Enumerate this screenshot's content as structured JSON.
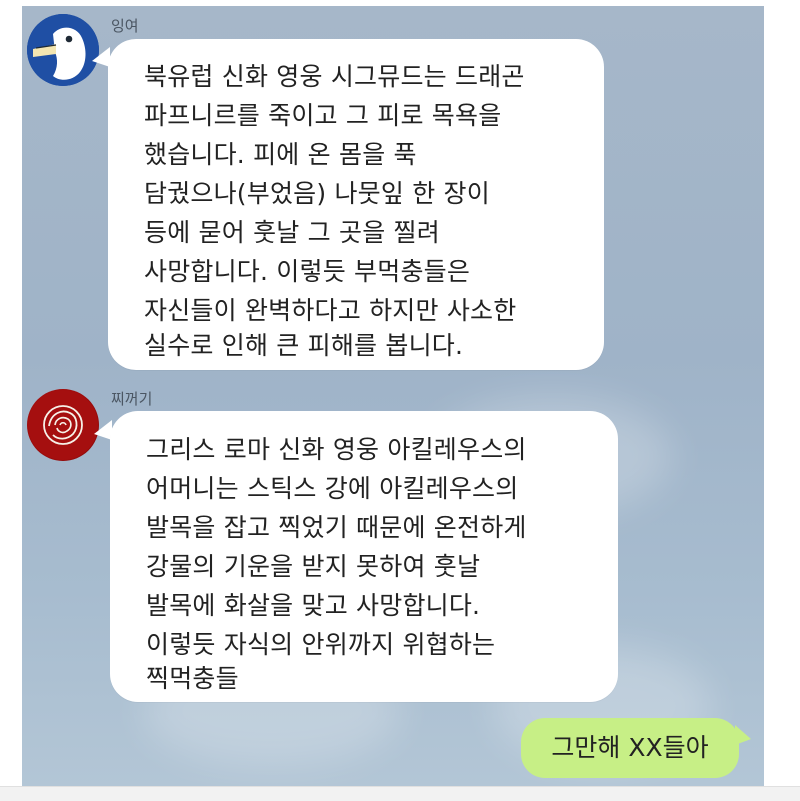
{
  "chat": {
    "messages": [
      {
        "sender": "잉여",
        "avatar": "duck-avatar",
        "lines": [
          "북유럽 신화 영웅 시그뮤드는 드래곤",
          "파프니르를 죽이고 그 피로 목욕을",
          "했습니다. 피에 온 몸을 푹",
          "담궜으나(부었음) 나뭇잎 한 장이",
          "등에 묻어 훗날 그 곳을 찔려",
          "사망합니다. 이렇듯 부먹충들은",
          "자신들이 완벽하다고 하지만 사소한",
          "실수로 인해 큰 피해를 봅니다."
        ]
      },
      {
        "sender": "찌꺼기",
        "avatar": "red-rose-avatar",
        "lines": [
          "그리스 로마 신화 영웅 아킬레우스의",
          "어머니는 스틱스 강에 아킬레우스의",
          "발목을 잡고 찍었기 때문에 온전하게",
          "강물의 기운을 받지 못하여 훗날",
          "발목에 화살을 맞고 사망합니다.",
          "이렇듯 자식의 안위까지 위협하는",
          "찍먹충들"
        ]
      }
    ],
    "reply": {
      "text": "그만해 XX들아"
    }
  },
  "colors": {
    "background": "#a6b7c9",
    "incoming_bubble": "#ffffff",
    "outgoing_bubble": "#c7ef86",
    "text": "#222222"
  }
}
